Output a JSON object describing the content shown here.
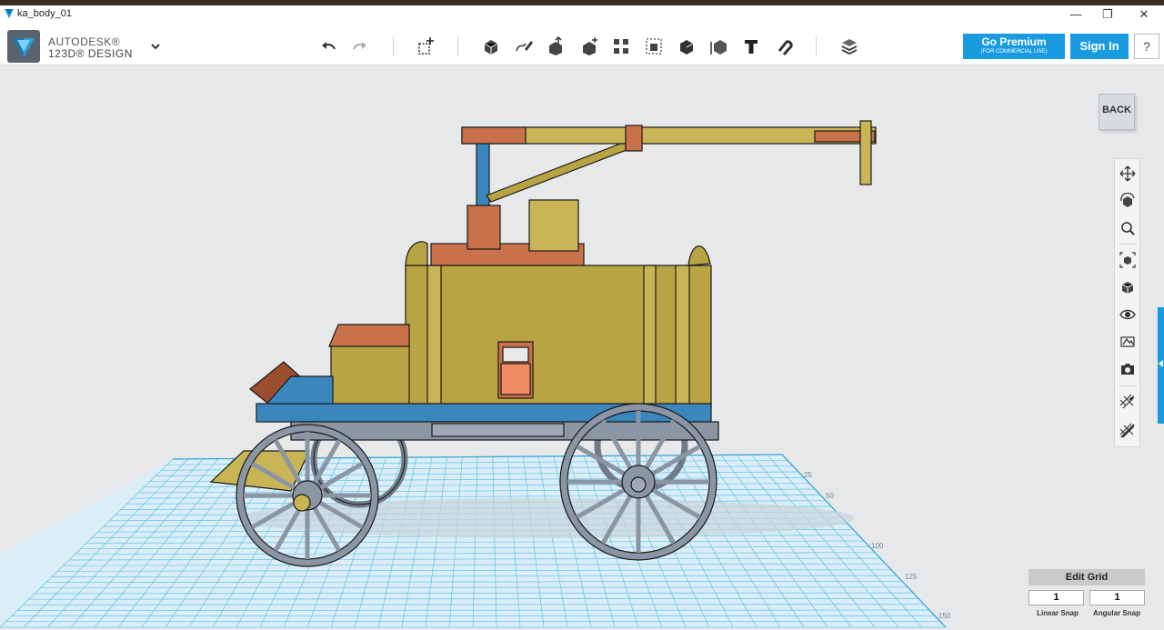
{
  "window": {
    "title": "ka_body_01",
    "minimize_glyph": "—",
    "restore_glyph": "❐",
    "close_glyph": "✕"
  },
  "brand": {
    "company": "AUTODESK®",
    "product": "123D® DESIGN"
  },
  "toolbar": {
    "tools": [
      "undo",
      "redo",
      "primitives",
      "sketch",
      "construct",
      "modify",
      "pattern",
      "grouping",
      "combine",
      "measure",
      "text",
      "snap",
      "material"
    ]
  },
  "account": {
    "premium_label": "Go Premium",
    "premium_sublabel": "(FOR COMMERCIAL USE)",
    "signin_label": "Sign In",
    "help_label": "?"
  },
  "viewcube": {
    "face_label": "BACK"
  },
  "navbar": {
    "tools": [
      "pan",
      "orbit",
      "zoom",
      "fit",
      "views",
      "visibility",
      "materials-and-outlines",
      "screenshot",
      "snap-to-grid",
      "grid-visibility"
    ]
  },
  "grid_panel": {
    "edit_grid_label": "Edit Grid",
    "linear_snap_value": "1",
    "angular_snap_value": "1",
    "linear_snap_label": "Linear Snap",
    "angular_snap_label": "Angular Snap"
  },
  "scene": {
    "grid_tick_labels": [
      "25",
      "50",
      "100",
      "125",
      "150"
    ],
    "colors": {
      "body_yellow": "#b9a443",
      "body_yellow_light": "#c9b555",
      "body_orange": "#c9714a",
      "body_orange_light": "#f08d64",
      "chassis_blue": "#3a86bd",
      "wheel_gray": "#8a96a4",
      "grid_line": "#5fc1e9",
      "grid_bg": "#ddeef6",
      "accent": "#1a9be0"
    }
  }
}
